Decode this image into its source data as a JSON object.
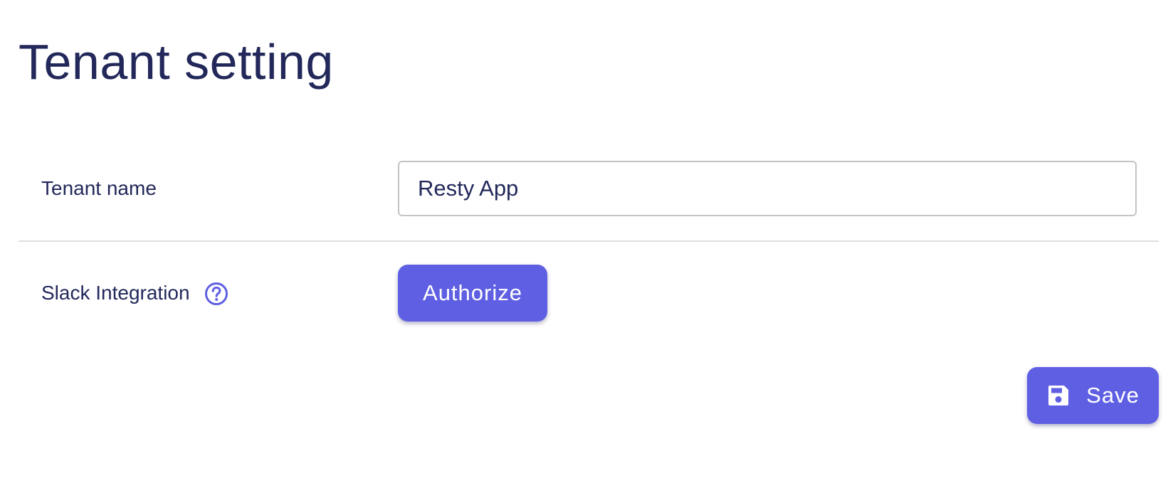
{
  "page": {
    "title": "Tenant setting"
  },
  "form": {
    "tenant_name": {
      "label": "Tenant name",
      "value": "Resty App"
    },
    "slack_integration": {
      "label": "Slack Integration",
      "help_icon": "help-circle-icon",
      "button_label": "Authorize"
    }
  },
  "actions": {
    "save_label": "Save",
    "save_icon": "floppy-disk-icon"
  },
  "colors": {
    "primary": "#5f5fe3",
    "text": "#22285a",
    "divider": "#dedee2",
    "field_border": "#c4c4c8"
  }
}
